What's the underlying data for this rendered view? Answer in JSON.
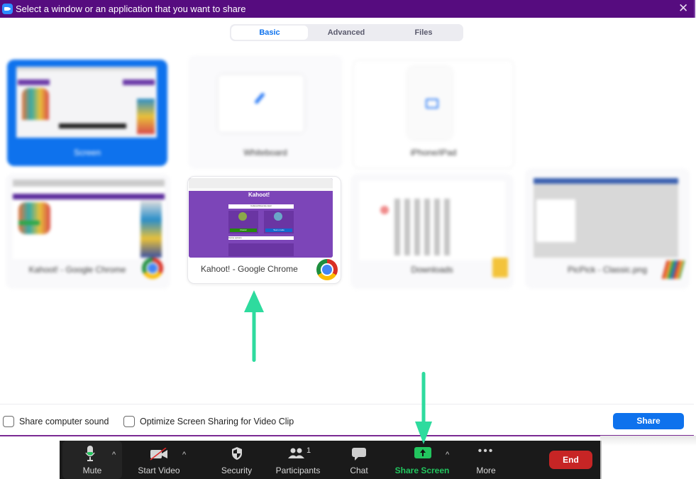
{
  "titlebar": {
    "title": "Select a window or an application that you want to share",
    "close_icon": "close-icon",
    "app_icon": "zoom-app-icon"
  },
  "tabs": [
    {
      "label": "Basic",
      "active": true
    },
    {
      "label": "Advanced",
      "active": false
    },
    {
      "label": "Files",
      "active": false
    }
  ],
  "share_items": [
    {
      "label": "Screen",
      "selected": true,
      "blurred": true
    },
    {
      "label": "Whiteboard",
      "selected": false,
      "blurred": true,
      "icon": "pencil-icon"
    },
    {
      "label": "iPhone/iPad",
      "selected": false,
      "blurred": true,
      "icon": "airplay-icon"
    },
    {
      "label": "Kahoot! - Google Chrome",
      "selected": false,
      "blurred": true,
      "icon": "chrome-icon"
    },
    {
      "label": "Kahoot! - Google Chrome",
      "selected": false,
      "blurred": false,
      "highlighted": true,
      "icon": "chrome-icon"
    },
    {
      "label": "Downloads",
      "selected": false,
      "blurred": true,
      "icon": "folder-icon"
    },
    {
      "label": "PicPick - Classic.png",
      "selected": false,
      "blurred": true,
      "icon": "picpick-icon"
    }
  ],
  "kahoot_preview": {
    "logo": "Kahoot!",
    "quiz_title": "Cultural Diversity Quiz",
    "option_left": "Classic",
    "option_right": "Team mode",
    "dropdown": "Game options"
  },
  "options": {
    "share_sound": {
      "label": "Share computer sound",
      "checked": false
    },
    "optimize_video": {
      "label": "Optimize Screen Sharing for Video Clip",
      "checked": false
    }
  },
  "share_button": "Share",
  "toolbar": {
    "mute": "Mute",
    "start_video": "Start Video",
    "security": "Security",
    "participants": "Participants",
    "participant_count": "1",
    "chat": "Chat",
    "share_screen": "Share Screen",
    "more": "More",
    "end": "End"
  },
  "colors": {
    "titlebar": "#560c7f",
    "accent_blue": "#0e72ed",
    "share_green": "#22c55e",
    "end_red": "#c72525",
    "annotation_arrow": "#2edb9e"
  }
}
